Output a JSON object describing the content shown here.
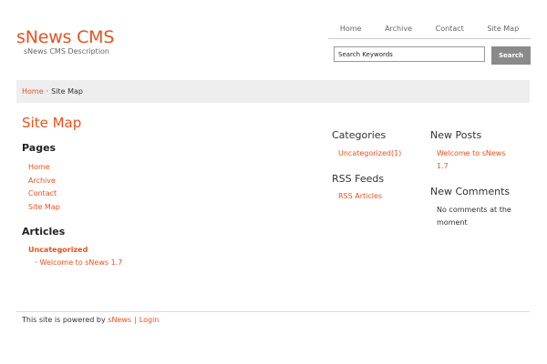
{
  "site": {
    "title": "sNews CMS",
    "description": "sNews CMS Description"
  },
  "topnav": [
    "Home",
    "Archive",
    "Contact",
    "Site Map"
  ],
  "search": {
    "value": "Search Keywords",
    "button": "Search"
  },
  "breadcrumb": {
    "home": "Home",
    "separator": "·",
    "current": "Site Map"
  },
  "main": {
    "title": "Site Map",
    "pages_heading": "Pages",
    "pages": [
      "Home",
      "Archive",
      "Contact",
      "Site Map"
    ],
    "articles_heading": "Articles",
    "category": "Uncategorized",
    "article_bullet": "·",
    "article": "Welcome to sNews 1.7"
  },
  "sidebar": {
    "categories_heading": "Categories",
    "category_item": "Uncategorized(1)",
    "rss_heading": "RSS Feeds",
    "rss_item": "RSS Articles",
    "new_posts_heading": "New Posts",
    "new_post_line1": "Welcome to sNews",
    "new_post_line2": "1.7",
    "new_comments_heading": "New Comments",
    "no_comments_line1": "No comments at the",
    "no_comments_line2": "moment"
  },
  "footer": {
    "text": "This site is powered by",
    "snews": "sNews",
    "separator": "|",
    "login": "Login"
  }
}
